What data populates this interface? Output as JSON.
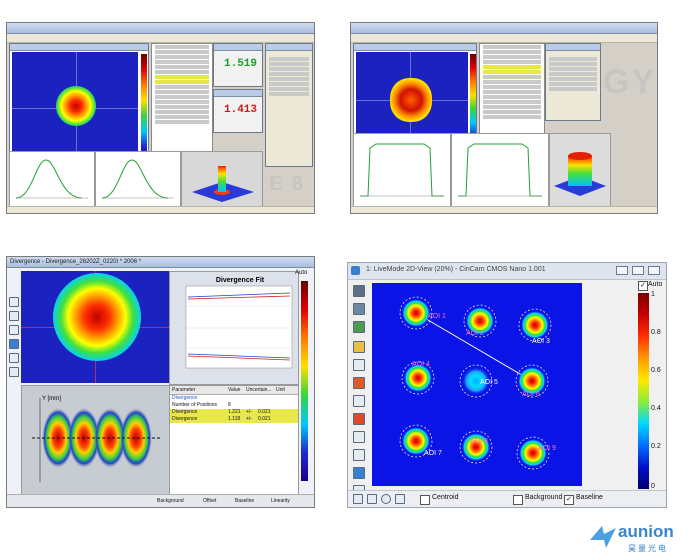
{
  "q1": {
    "readout_a": "1.519",
    "readout_b": "1.413"
  },
  "q3": {
    "title": "Divergence - Divergence_26202Z_0220I * 2006 *",
    "chart_title": "Divergence Fit",
    "table_headers": [
      "Parameter",
      "Value",
      "Uncertain...",
      "Unit"
    ],
    "table_rows": [
      [
        "Divergence",
        "",
        "",
        ""
      ],
      [
        "Number of Positions",
        "8",
        "",
        ""
      ],
      [
        "Divergence",
        "1.221",
        "+/-",
        "0.021"
      ],
      [
        "Divergence",
        "1.118",
        "+/-",
        "0.021"
      ]
    ],
    "y_label": "Y [mm]",
    "auto_label": "Auto",
    "footer_items": [
      "Background",
      "Offset",
      "Baseline",
      "Linearity"
    ]
  },
  "q4": {
    "title": "1: LiveMode 2D-View (20%) - CinCam CMOS Nano 1.001",
    "auto_label": "Auto",
    "scale_ticks": [
      "1",
      "0.8",
      "0.6",
      "0.4",
      "0.2",
      "0"
    ],
    "aois": [
      "AOI 1",
      "AOI 2",
      "AOI 3",
      "AOI 4",
      "AOI 5",
      "AOI 6",
      "AOI 7",
      "AOI 8",
      "AOI 9"
    ],
    "checkboxes": {
      "centroid": "Centroid",
      "background": "Background",
      "baseline": "Baseline"
    }
  },
  "brand": {
    "name": "aunion",
    "sub": "昊量光电"
  }
}
